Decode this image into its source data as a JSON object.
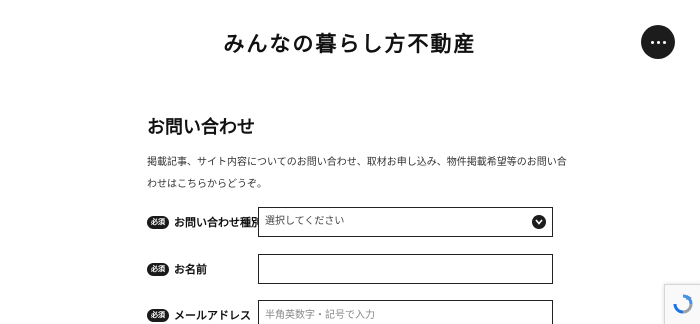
{
  "header": {
    "site_title": "みんなの暮らし方不動産",
    "menu_icon": "more-horizontal-icon"
  },
  "main": {
    "title": "お問い合わせ",
    "description": "掲載記事、サイト内容についてのお問い合わせ、取材お申し込み、物件掲載希望等のお問い合わせはこちらからどうぞ。"
  },
  "form": {
    "inquiry_type": {
      "required_badge": "必須",
      "label": "お問い合わせ種別",
      "selected_value": "選択してください"
    },
    "name": {
      "required_badge": "必須",
      "label": "お名前",
      "value": ""
    },
    "email": {
      "required_badge": "必須",
      "label": "メールアドレス",
      "placeholder": "半角英数字・記号で入力"
    }
  },
  "colors": {
    "text": "#222222",
    "accent_dark": "#1c1c1c",
    "background": "#ffffff"
  },
  "icons": {
    "select_chevron": "chevron-down-icon",
    "recaptcha": "recaptcha-icon"
  }
}
